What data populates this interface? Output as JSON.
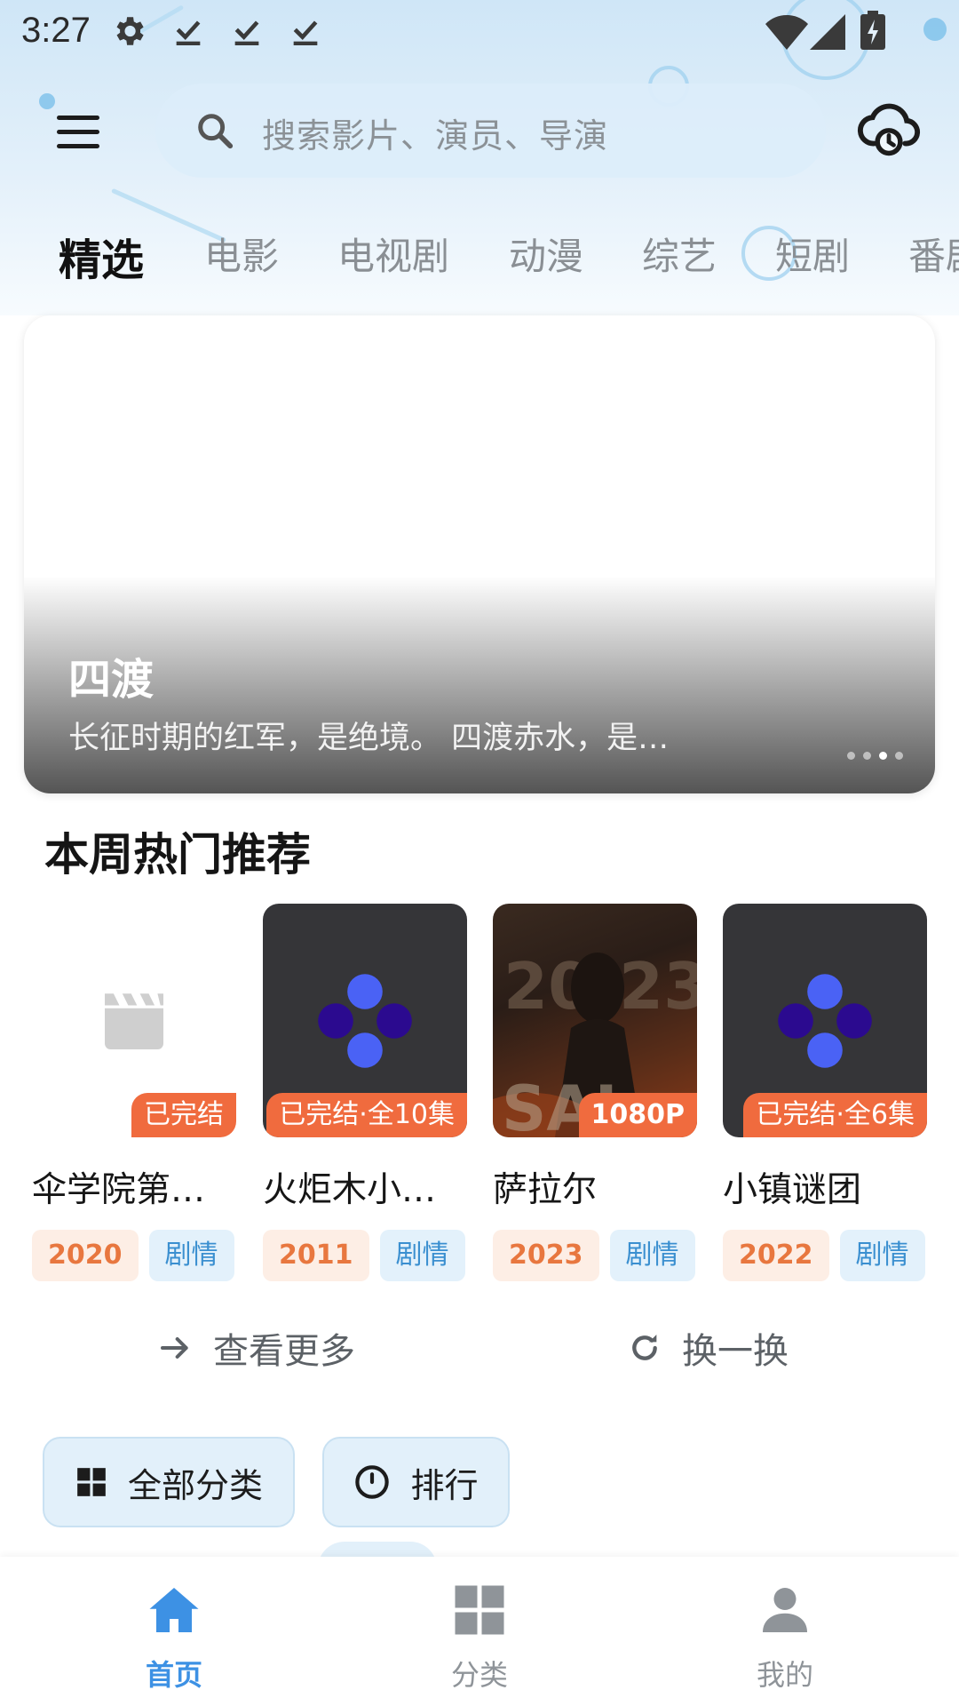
{
  "status_bar": {
    "time": "3:27",
    "icons": [
      "gear-icon",
      "download-done-icon",
      "download-done-icon",
      "download-done-icon",
      "wifi-icon",
      "signal-icon",
      "battery-charging-icon"
    ]
  },
  "header": {
    "menu_icon": "hamburger-menu-icon",
    "search": {
      "placeholder": "搜索影片、演员、导演"
    },
    "cloud_icon": "cloud-sync-icon"
  },
  "tabs": [
    {
      "label": "精选",
      "active": true
    },
    {
      "label": "电影",
      "active": false
    },
    {
      "label": "电视剧",
      "active": false
    },
    {
      "label": "动漫",
      "active": false
    },
    {
      "label": "综艺",
      "active": false
    },
    {
      "label": "短剧",
      "active": false
    },
    {
      "label": "番剧",
      "active": false
    }
  ],
  "banner": {
    "title": "四渡",
    "description": "长征时期的红军，是绝境。 四渡赤水，是…",
    "dots": 4,
    "active_dot": 2
  },
  "weekly": {
    "title": "本周热门推荐",
    "items": [
      {
        "title": "伞学院第…",
        "badge": "已完结",
        "year": "2020",
        "genre": "剧情",
        "poster": "placeholder-clapperboard"
      },
      {
        "title": "火炬木小…",
        "badge": "已完结·全10集",
        "year": "2011",
        "genre": "剧情",
        "poster": "app-logo"
      },
      {
        "title": "萨拉尔",
        "badge": "1080P",
        "year": "2023",
        "genre": "剧情",
        "poster": "photo"
      },
      {
        "title": "小镇谜团",
        "badge": "已完结·全6集",
        "year": "2022",
        "genre": "剧情",
        "poster": "app-logo"
      }
    ],
    "more_label": "查看更多",
    "refresh_label": "换一换"
  },
  "quick_buttons": {
    "all_categories": "全部分类",
    "ranking": "排行"
  },
  "bottom_nav": [
    {
      "label": "首页",
      "icon": "home-icon",
      "active": true
    },
    {
      "label": "分类",
      "icon": "grid-icon",
      "active": false
    },
    {
      "label": "我的",
      "icon": "person-icon",
      "active": false
    }
  ],
  "colors": {
    "accent_blue": "#3d91e4",
    "badge_orange": "#f06b3e",
    "year_tag_text": "#e8773f",
    "genre_tag_text": "#3a8fd0",
    "header_bg": "#cfe6f7"
  }
}
